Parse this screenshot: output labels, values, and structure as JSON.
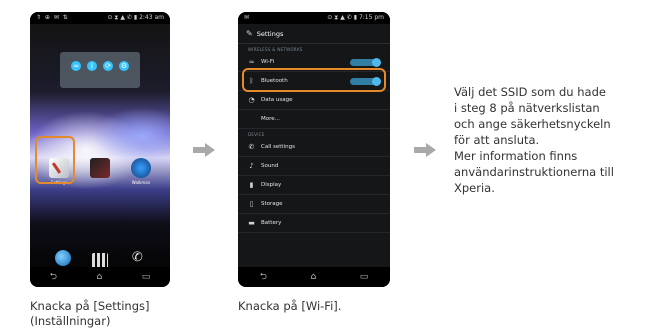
{
  "phone1": {
    "status_left": "⇑ ⊕ ✉ ⇅",
    "status_right": "⊙ ⧗ ▲ ✆ ▮ 2:43 am",
    "apps": [
      "Settings",
      "",
      "Walkman"
    ],
    "dock": [
      "Browser",
      "",
      "Dial"
    ],
    "nav": [
      "⮌",
      "⌂",
      "▭"
    ]
  },
  "phone2": {
    "status_left": "✉",
    "status_right": "⊙ ⧗ ▲ ✆ ▮ 7:15 pm",
    "title": "Settings",
    "section1": "WIRELESS & NETWORKS",
    "items1": [
      {
        "label": "Wi-Fi",
        "icon": "wifi-icon",
        "toggle": true
      },
      {
        "label": "Bluetooth",
        "icon": "bluetooth-icon",
        "toggle": true
      },
      {
        "label": "Data usage",
        "icon": "data-usage-icon",
        "toggle": false
      },
      {
        "label": "More...",
        "icon": "",
        "toggle": false
      }
    ],
    "section2": "DEVICE",
    "items2": [
      {
        "label": "Call settings",
        "icon": "phone-icon"
      },
      {
        "label": "Sound",
        "icon": "speaker-icon"
      },
      {
        "label": "Display",
        "icon": "display-icon"
      },
      {
        "label": "Storage",
        "icon": "storage-icon"
      },
      {
        "label": "Battery",
        "icon": "battery-icon"
      }
    ],
    "nav": [
      "⮌",
      "⌂",
      "▭"
    ]
  },
  "captions": {
    "step1_line1": "Knacka på [Settings]",
    "step1_line2": "(Inställningar)",
    "step2": "Knacka på [Wi-Fi]."
  },
  "instructions": {
    "lines": [
      "Välj det SSID som du hade",
      "i steg 8 på nätverkslistan",
      "och ange säkerhetsnyckeln",
      "för att ansluta.",
      "Mer information finns",
      "användarinstruktionerna till",
      "Xperia."
    ]
  },
  "colors": {
    "highlight": "#e28a2c",
    "arrow": "#a9a9a9",
    "toggle_on": "#4fb7ea"
  }
}
